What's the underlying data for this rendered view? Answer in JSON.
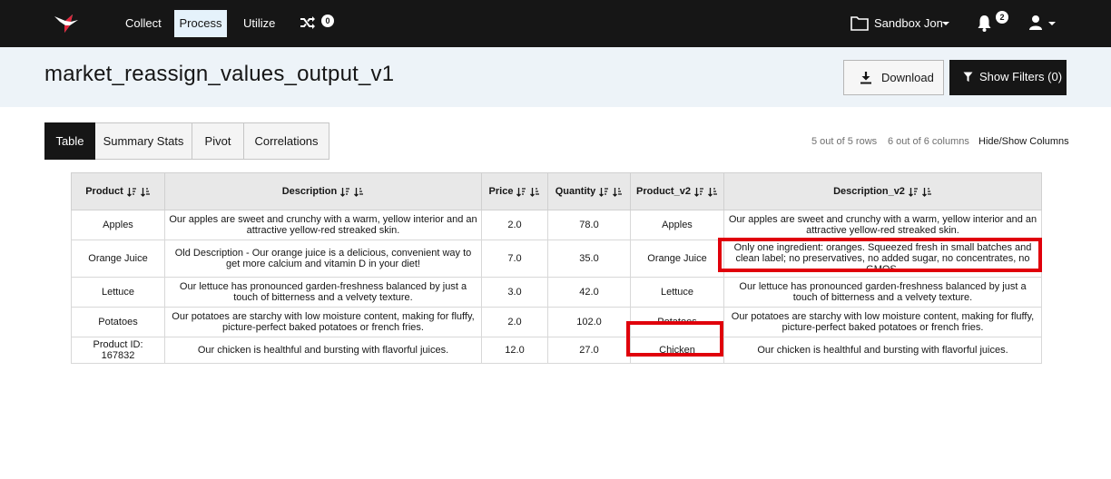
{
  "nav": {
    "items": [
      {
        "label": "Collect"
      },
      {
        "label": "Process",
        "active": true
      },
      {
        "label": "Utilize"
      }
    ],
    "shuffle_icon": "shuffle-icon",
    "shuffle_badge": "0",
    "sandbox_label": "Sandbox Jon",
    "notifications_badge": "2",
    "colors": {
      "bar": "#161616",
      "active_bg": "#e5f2fb",
      "logo_accent": "#e0243a"
    }
  },
  "page": {
    "title": "market_reassign_values_output_v1",
    "download_label": "Download",
    "filters_label": "Show Filters (0)"
  },
  "tabs": [
    {
      "label": "Table",
      "active": true
    },
    {
      "label": "Summary Stats"
    },
    {
      "label": "Pivot"
    },
    {
      "label": "Correlations"
    }
  ],
  "table_meta": {
    "rows_text": "5 out of 5 rows",
    "columns_text": "6 out of 6 columns",
    "hide_show_label": "Hide/Show Columns"
  },
  "table": {
    "columns": [
      "Product",
      "Description",
      "Price",
      "Quantity",
      "Product_v2",
      "Description_v2"
    ],
    "rows": [
      [
        "Apples",
        "Our apples are sweet and crunchy with a warm, yellow interior and an attractive yellow-red streaked skin.",
        "2.0",
        "78.0",
        "Apples",
        "Our apples are sweet and crunchy with a warm, yellow interior and an attractive yellow-red streaked skin."
      ],
      [
        "Orange Juice",
        "Old Description - Our orange juice is a delicious, convenient way to get more calcium and vitamin D in your diet!",
        "7.0",
        "35.0",
        "Orange Juice",
        "Only one ingredient: oranges. Squeezed fresh in small batches and clean label; no preservatives, no added sugar, no concentrates, no GMOS."
      ],
      [
        "Lettuce",
        "Our lettuce has pronounced garden-freshness balanced by just a touch of bitterness and a velvety texture.",
        "3.0",
        "42.0",
        "Lettuce",
        "Our lettuce has pronounced garden-freshness balanced by just a touch of bitterness and a velvety texture."
      ],
      [
        "Potatoes",
        "Our potatoes are starchy with low moisture content, making for fluffy, picture-perfect baked potatoes or french fries.",
        "2.0",
        "102.0",
        "Potatoes",
        "Our potatoes are starchy with low moisture content, making for fluffy, picture-perfect baked potatoes or french fries."
      ],
      [
        "Product ID: 167832",
        "Our chicken is healthful and bursting with flavorful juices.",
        "12.0",
        "27.0",
        "Chicken",
        "Our chicken is healthful and bursting with flavorful juices."
      ]
    ]
  },
  "annotations": {
    "highlight_color": "#e0000b"
  }
}
